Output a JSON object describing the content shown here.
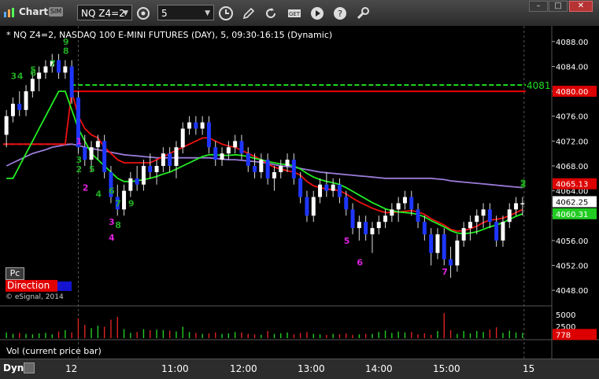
{
  "titlebar": {
    "app_label": "Chart",
    "sim_badge": "SIM",
    "symbol": "NQ Z4=2",
    "interval": "5",
    "icons": [
      "refresh-icon",
      "clock-icon",
      "pencil-icon",
      "link-icon",
      "get-icon",
      "play-icon",
      "help-icon",
      "settings-icon"
    ],
    "window_buttons": [
      "minimize",
      "maximize",
      "close"
    ]
  },
  "chart": {
    "header": "* NQ Z4=2, NASDAQ 100 E-MINI FUTURES (DAY), 5, 09:30-16:15 (Dynamic)",
    "copyright": "© eSignal, 2014",
    "pc_label": "Pc",
    "direction_label": "Direction",
    "vol_label": "Vol (current price bar)",
    "scale_toggle": "Dyn"
  },
  "chart_data": {
    "type": "candlestick",
    "y_axis": {
      "min": 4046,
      "max": 4090,
      "ticks": [
        4088,
        4084,
        4080,
        4076,
        4072,
        4068,
        4064,
        4060,
        4056,
        4052,
        4048
      ]
    },
    "x_axis": {
      "ticks": [
        "12",
        "11:00",
        "12:00",
        "13:00",
        "14:00",
        "15:00",
        "15"
      ]
    },
    "price_labels": [
      {
        "label": "4081",
        "value": 4081,
        "color": "#22dd22",
        "style": "text"
      },
      {
        "label": "4080.00",
        "value": 4080,
        "color": "#dd0000",
        "style": "box"
      },
      {
        "label": "4065.13",
        "value": 4065.13,
        "color": "#dd0000",
        "style": "box"
      },
      {
        "label": "4062.25",
        "value": 4062.25,
        "color": "#ffffff",
        "style": "box"
      },
      {
        "label": "4060.31",
        "value": 4060.31,
        "color": "#22cc22",
        "style": "box"
      }
    ],
    "horizontal_lines": [
      {
        "name": "green-dashed-level",
        "value": 4081,
        "color": "#22dd22",
        "dashed": true,
        "from": 0.13
      },
      {
        "name": "red-level",
        "value": 4080,
        "color": "#ee0000",
        "dashed": false,
        "from": 0.13
      },
      {
        "name": "red-dashed-prior",
        "value": 4071.5,
        "color": "#ff2222",
        "dashed": true,
        "from": 0,
        "to": 0.13
      }
    ],
    "candles": [
      [
        4073,
        4077,
        4071,
        4076
      ],
      [
        4076,
        4079,
        4075,
        4078
      ],
      [
        4078,
        4080,
        4076,
        4077
      ],
      [
        4077,
        4081,
        4076,
        4080
      ],
      [
        4080,
        4083,
        4079,
        4082
      ],
      [
        4082,
        4084,
        4080,
        4083
      ],
      [
        4083,
        4085,
        4082,
        4084
      ],
      [
        4084,
        4086,
        4083,
        4085
      ],
      [
        4085,
        4086,
        4082,
        4083
      ],
      [
        4083,
        4085,
        4082,
        4084
      ],
      [
        4084,
        4085,
        4078,
        4079
      ],
      [
        4079,
        4080,
        4070,
        4071
      ],
      [
        4071,
        4073,
        4068,
        4069
      ],
      [
        4069,
        4072,
        4067,
        4071
      ],
      [
        4071,
        4073,
        4069,
        4072
      ],
      [
        4072,
        4073,
        4066,
        4067
      ],
      [
        4067,
        4068,
        4062,
        4063
      ],
      [
        4063,
        4065,
        4060,
        4061
      ],
      [
        4061,
        4065,
        4060,
        4064
      ],
      [
        4064,
        4067,
        4063,
        4066
      ],
      [
        4066,
        4068,
        4064,
        4065
      ],
      [
        4065,
        4069,
        4064,
        4068
      ],
      [
        4068,
        4070,
        4066,
        4067
      ],
      [
        4067,
        4069,
        4065,
        4068
      ],
      [
        4068,
        4071,
        4067,
        4070
      ],
      [
        4070,
        4071,
        4067,
        4068
      ],
      [
        4068,
        4072,
        4066,
        4071
      ],
      [
        4071,
        4075,
        4070,
        4074
      ],
      [
        4074,
        4076,
        4073,
        4075
      ],
      [
        4075,
        4076,
        4073,
        4074
      ],
      [
        4074,
        4076,
        4073,
        4075
      ],
      [
        4075,
        4076,
        4070,
        4071
      ],
      [
        4071,
        4072,
        4068,
        4069
      ],
      [
        4069,
        4071,
        4068,
        4070
      ],
      [
        4070,
        4072,
        4069,
        4071
      ],
      [
        4071,
        4073,
        4070,
        4072
      ],
      [
        4072,
        4073,
        4069,
        4070
      ],
      [
        4070,
        4071,
        4067,
        4068
      ],
      [
        4068,
        4070,
        4066,
        4067
      ],
      [
        4067,
        4070,
        4066,
        4069
      ],
      [
        4069,
        4070,
        4065,
        4066
      ],
      [
        4066,
        4068,
        4064,
        4067
      ],
      [
        4067,
        4069,
        4066,
        4068
      ],
      [
        4068,
        4070,
        4067,
        4069
      ],
      [
        4069,
        4070,
        4065,
        4066
      ],
      [
        4066,
        4067,
        4062,
        4063
      ],
      [
        4063,
        4064,
        4059,
        4060
      ],
      [
        4060,
        4064,
        4059,
        4063
      ],
      [
        4063,
        4066,
        4062,
        4065
      ],
      [
        4065,
        4067,
        4063,
        4064
      ],
      [
        4064,
        4066,
        4063,
        4065
      ],
      [
        4065,
        4066,
        4062,
        4063
      ],
      [
        4063,
        4064,
        4060,
        4061
      ],
      [
        4061,
        4062,
        4057,
        4058
      ],
      [
        4058,
        4060,
        4056,
        4059
      ],
      [
        4059,
        4060,
        4056,
        4057
      ],
      [
        4057,
        4059,
        4054,
        4058
      ],
      [
        4058,
        4060,
        4057,
        4059
      ],
      [
        4059,
        4061,
        4058,
        4060
      ],
      [
        4060,
        4062,
        4059,
        4061
      ],
      [
        4061,
        4063,
        4059,
        4062
      ],
      [
        4062,
        4064,
        4061,
        4063
      ],
      [
        4063,
        4064,
        4060,
        4061
      ],
      [
        4061,
        4062,
        4058,
        4059
      ],
      [
        4059,
        4060,
        4056,
        4057
      ],
      [
        4057,
        4058,
        4052,
        4054
      ],
      [
        4054,
        4058,
        4053,
        4057
      ],
      [
        4057,
        4058,
        4052,
        4053
      ],
      [
        4053,
        4055,
        4050,
        4052
      ],
      [
        4052,
        4057,
        4051,
        4056
      ],
      [
        4056,
        4059,
        4055,
        4058
      ],
      [
        4058,
        4060,
        4056,
        4059
      ],
      [
        4059,
        4061,
        4057,
        4060
      ],
      [
        4060,
        4062,
        4058,
        4061
      ],
      [
        4061,
        4062,
        4058,
        4059
      ],
      [
        4059,
        4060,
        4055,
        4056
      ],
      [
        4056,
        4060,
        4055,
        4059
      ],
      [
        4059,
        4062,
        4058,
        4061
      ],
      [
        4061,
        4063,
        4060,
        4062
      ],
      [
        4062,
        4063,
        4060,
        4062
      ]
    ],
    "red_ma": [
      4071.5,
      4071.5,
      4071.5,
      4071.5,
      4071.5,
      4071.5,
      4071.5,
      4071.5,
      4071.5,
      4071.5,
      4080,
      4076,
      4074,
      4073,
      4072.5,
      4071,
      4070,
      4069,
      4068.5,
      4068.5,
      4068.5,
      4068.5,
      4068.5,
      4069,
      4069.5,
      4070,
      4070.5,
      4071,
      4071.5,
      4072,
      4072.5,
      4072.5,
      4072,
      4071.5,
      4071.2,
      4071,
      4070.5,
      4070,
      4069.5,
      4069,
      4068.3,
      4067.8,
      4067.5,
      4067.2,
      4067,
      4066.5,
      4065.5,
      4064.8,
      4064.5,
      4064.3,
      4064.2,
      4064,
      4063.5,
      4062.8,
      4062.2,
      4061.7,
      4061.2,
      4060.8,
      4060.5,
      4060.5,
      4060.6,
      4060.7,
      4060.8,
      4060.6,
      4060.2,
      4059.5,
      4059,
      4058.5,
      4057.8,
      4057.5,
      4057.6,
      4057.9,
      4058.3,
      4058.9,
      4059.3,
      4059.4,
      4059.6,
      4060,
      4060.5,
      4061
    ],
    "green_ma": [
      4066,
      4066,
      4068,
      4070,
      4072,
      4074,
      4076,
      4078,
      4080,
      4080,
      4077,
      4074,
      4072,
      4070,
      4069,
      4068,
      4067,
      4066,
      4065.5,
      4065.5,
      4065.6,
      4065.8,
      4066,
      4066.3,
      4066.7,
      4067,
      4067.5,
      4068,
      4068.5,
      4069,
      4069.5,
      4069.8,
      4069.8,
      4069.7,
      4069.7,
      4069.8,
      4069.7,
      4069.5,
      4069.2,
      4069,
      4068.7,
      4068.5,
      4068.3,
      4068.2,
      4068,
      4067.5,
      4066.8,
      4066.2,
      4065.8,
      4065.5,
      4065.3,
      4065,
      4064.5,
      4063.9,
      4063.3,
      4062.7,
      4062.1,
      4061.6,
      4061.1,
      4060.8,
      4060.6,
      4060.5,
      4060.4,
      4060.2,
      4059.8,
      4059.2,
      4058.7,
      4058.2,
      4057.6,
      4057.2,
      4057.1,
      4057.2,
      4057.4,
      4057.8,
      4058.2,
      4058.5,
      4058.9,
      4059.4,
      4059.9,
      4060.3
    ],
    "purple_ma": [
      4068,
      4068.5,
      4069,
      4069.5,
      4070,
      4070.3,
      4070.6,
      4071,
      4071.2,
      4071.4,
      4071.5,
      4071.3,
      4071,
      4070.8,
      4070.6,
      4070.4,
      4070.2,
      4070,
      4069.8,
      4069.7,
      4069.6,
      4069.5,
      4069.4,
      4069.3,
      4069.3,
      4069.3,
      4069.3,
      4069.3,
      4069.3,
      4069.3,
      4069.3,
      4069.3,
      4069.2,
      4069.1,
      4069,
      4069,
      4068.9,
      4068.8,
      4068.7,
      4068.6,
      4068.4,
      4068.2,
      4068,
      4067.9,
      4067.8,
      4067.6,
      4067.4,
      4067.2,
      4067,
      4066.9,
      4066.8,
      4066.7,
      4066.6,
      4066.5,
      4066.4,
      4066.3,
      4066.2,
      4066.1,
      4066,
      4066,
      4066,
      4066,
      4066,
      4066,
      4066,
      4066,
      4065.9,
      4065.8,
      4065.6,
      4065.5,
      4065.4,
      4065.3,
      4065.2,
      4065.1,
      4065,
      4064.9,
      4064.8,
      4064.7,
      4064.6,
      4064.5
    ],
    "sequence_labels": [
      {
        "text": "9",
        "index": 9,
        "value": 4087.5,
        "color": "#22aa22"
      },
      {
        "text": "8",
        "index": 9,
        "value": 4086,
        "color": "#22aa22"
      },
      {
        "text": "7",
        "index": 7,
        "value": 4084,
        "color": "#22aa22"
      },
      {
        "text": "6",
        "index": 4,
        "value": 4082.5,
        "color": "#22aa22"
      },
      {
        "text": "5",
        "index": 4,
        "value": 4083,
        "color": "#22aa22"
      },
      {
        "text": "4",
        "index": 2,
        "value": 4082,
        "color": "#22aa22"
      },
      {
        "text": "3",
        "index": 1,
        "value": 4082,
        "color": "#22aa22"
      },
      {
        "text": "1",
        "index": 11,
        "value": 4071.5,
        "color": "#dd22dd"
      },
      {
        "text": "2",
        "index": 11,
        "value": 4067,
        "color": "#22aa22"
      },
      {
        "text": "3",
        "index": 11,
        "value": 4068.5,
        "color": "#22aa22"
      },
      {
        "text": "5",
        "index": 13,
        "value": 4067,
        "color": "#22aa22"
      },
      {
        "text": "2",
        "index": 12,
        "value": 4064,
        "color": "#dd22dd"
      },
      {
        "text": "4",
        "index": 14,
        "value": 4063,
        "color": "#22aa22"
      },
      {
        "text": "6",
        "index": 16,
        "value": 4063.5,
        "color": "#22aa22"
      },
      {
        "text": "7",
        "index": 17,
        "value": 4061.5,
        "color": "#22aa22"
      },
      {
        "text": "9",
        "index": 19,
        "value": 4061.5,
        "color": "#22aa22"
      },
      {
        "text": "3",
        "index": 16,
        "value": 4058.5,
        "color": "#dd22dd"
      },
      {
        "text": "8",
        "index": 17,
        "value": 4058,
        "color": "#22aa22"
      },
      {
        "text": "4",
        "index": 16,
        "value": 4056,
        "color": "#dd22dd"
      },
      {
        "text": "5",
        "index": 52,
        "value": 4055.5,
        "color": "#dd22dd"
      },
      {
        "text": "6",
        "index": 54,
        "value": 4052,
        "color": "#dd22dd"
      },
      {
        "text": "7",
        "index": 67,
        "value": 4050.5,
        "color": "#dd22dd"
      },
      {
        "text": "2",
        "index": 79,
        "value": 4064.8,
        "color": "#22aa22"
      },
      {
        "text": "3",
        "index": 79,
        "value": 4064.5,
        "color": "#22aa22"
      }
    ],
    "volume": {
      "ticks": [
        5000,
        2500
      ],
      "last_label": "778",
      "bars": [
        1200,
        900,
        1100,
        900,
        800,
        1000,
        1100,
        800,
        1400,
        1700,
        1200,
        4200,
        2800,
        2100,
        2600,
        2400,
        3900,
        4500,
        1900,
        1100,
        1300,
        1900,
        1700,
        1800,
        1700,
        1600,
        1400,
        2400,
        1300,
        1100,
        900,
        1000,
        1200,
        900,
        1000,
        1300,
        1200,
        900,
        800,
        700,
        1500,
        900,
        1000,
        1200,
        800,
        1100,
        1300,
        900,
        800,
        700,
        900,
        800,
        1000,
        700,
        800,
        900,
        900,
        1300,
        1600,
        1100,
        1400,
        1200,
        1300,
        800,
        1000,
        700,
        1500,
        5300,
        1700,
        900,
        1500,
        1000,
        1500,
        1300,
        1800,
        2300,
        1100,
        1600,
        1200,
        1100
      ]
    }
  }
}
